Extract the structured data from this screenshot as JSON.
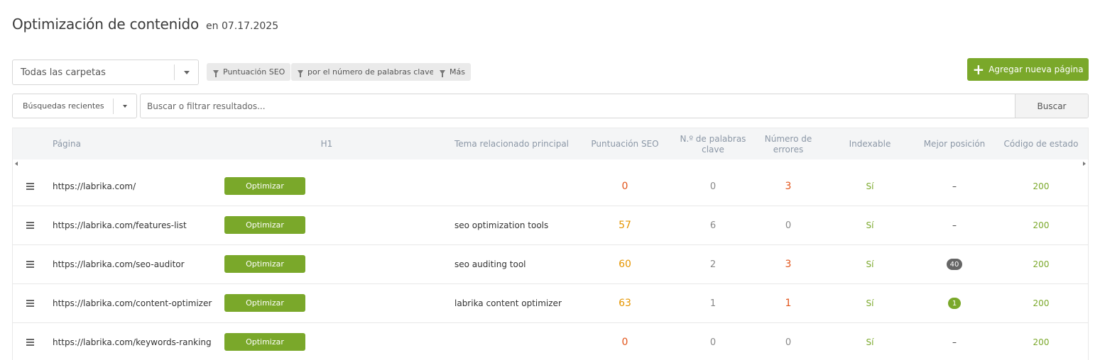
{
  "header": {
    "title": "Optimización de contenido",
    "date": "en 07.17.2025"
  },
  "folder_select": {
    "value": "Todas las carpetas"
  },
  "filters": [
    {
      "label": "Puntuación SEO"
    },
    {
      "label": "por el número de palabras clave"
    },
    {
      "label": "Más"
    }
  ],
  "add_button": {
    "label": "Agregar nueva página"
  },
  "recent_searches": {
    "value": "Búsquedas recientes"
  },
  "search": {
    "placeholder": "Buscar o filtrar resultados...",
    "button": "Buscar"
  },
  "table": {
    "columns": {
      "page": "Página",
      "h1": "H1",
      "topic": "Tema relacionado principal",
      "seo": "Puntuación SEO",
      "keywords": "N.º de palabras clave",
      "errors": "Número de errores",
      "indexable": "Indexable",
      "position": "Mejor posición",
      "status": "Código de estado"
    },
    "optimize_label": "Optimizar",
    "rows": [
      {
        "url": "https://labrika.com/",
        "h1": "",
        "topic": "",
        "seo": "0",
        "keywords": "0",
        "errors": "3",
        "indexable": "Sí",
        "position": "–",
        "status": "200"
      },
      {
        "url": "https://labrika.com/features-list",
        "h1": "",
        "topic": "seo optimization tools",
        "seo": "57",
        "keywords": "6",
        "errors": "0",
        "indexable": "Sí",
        "position": "–",
        "status": "200"
      },
      {
        "url": "https://labrika.com/seo-auditor",
        "h1": "",
        "topic": "seo auditing tool",
        "seo": "60",
        "keywords": "2",
        "errors": "3",
        "indexable": "Sí",
        "position": "40",
        "status": "200"
      },
      {
        "url": "https://labrika.com/content-optimizer",
        "h1": "",
        "topic": "labrika content optimizer",
        "seo": "63",
        "keywords": "1",
        "errors": "1",
        "indexable": "Sí",
        "position": "1",
        "status": "200"
      },
      {
        "url": "https://labrika.com/keywords-ranking",
        "h1": "",
        "topic": "",
        "seo": "0",
        "keywords": "0",
        "errors": "0",
        "indexable": "Sí",
        "position": "–",
        "status": "200"
      }
    ]
  },
  "colors": {
    "brand_green": "#7aa82a",
    "seo_low": "#e2541a",
    "seo_mid": "#e59500",
    "pill_grey": "#666666",
    "pill_green": "#7aa82a"
  }
}
